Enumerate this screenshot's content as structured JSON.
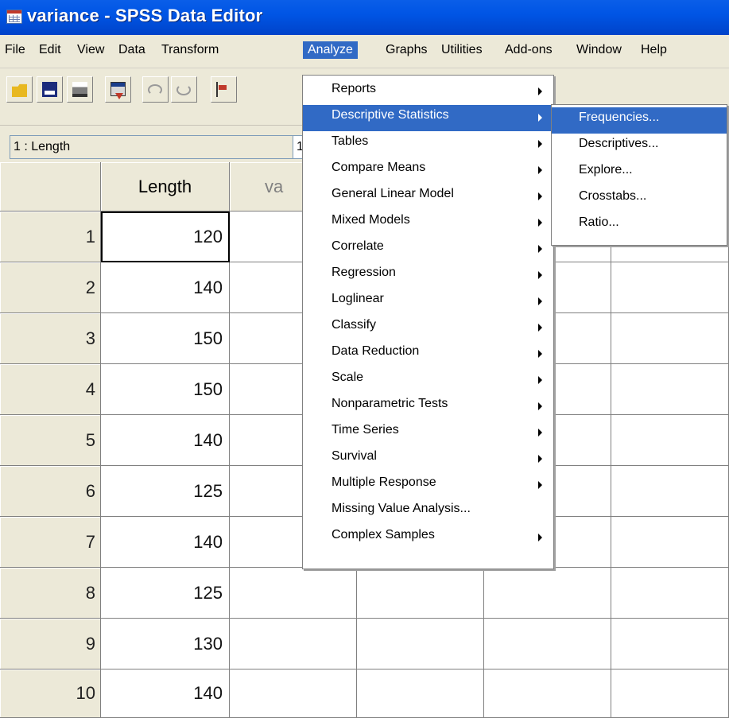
{
  "window": {
    "title": "variance - SPSS Data Editor"
  },
  "menubar": {
    "items": [
      {
        "label": "File"
      },
      {
        "label": "Edit"
      },
      {
        "label": "View"
      },
      {
        "label": "Data"
      },
      {
        "label": "Transform"
      },
      {
        "label": "Analyze"
      },
      {
        "label": "Graphs"
      },
      {
        "label": "Utilities"
      },
      {
        "label": "Add-ons"
      },
      {
        "label": "Window"
      },
      {
        "label": "Help"
      }
    ],
    "open_menu": "Analyze"
  },
  "toolbar": {
    "buttons": [
      "open-file-icon",
      "save-icon",
      "print-icon",
      "dialog-recall-icon",
      "undo-icon",
      "redo-icon",
      "goto-case-icon"
    ]
  },
  "cell_editor": {
    "reference": "1 : Length",
    "value": "1"
  },
  "grid": {
    "columns": [
      "Length",
      "va"
    ],
    "rows": [
      {
        "n": "1",
        "length": "120"
      },
      {
        "n": "2",
        "length": "140"
      },
      {
        "n": "3",
        "length": "150"
      },
      {
        "n": "4",
        "length": "150"
      },
      {
        "n": "5",
        "length": "140"
      },
      {
        "n": "6",
        "length": "125"
      },
      {
        "n": "7",
        "length": "140"
      },
      {
        "n": "8",
        "length": "125"
      },
      {
        "n": "9",
        "length": "130"
      },
      {
        "n": "10",
        "length": "140"
      }
    ]
  },
  "analyze_menu": {
    "items": [
      {
        "label": "Reports",
        "submenu": true
      },
      {
        "label": "Descriptive Statistics",
        "submenu": true,
        "highlighted": true
      },
      {
        "label": "Tables",
        "submenu": true
      },
      {
        "label": "Compare Means",
        "submenu": true
      },
      {
        "label": "General Linear Model",
        "submenu": true
      },
      {
        "label": "Mixed Models",
        "submenu": true
      },
      {
        "label": "Correlate",
        "submenu": true
      },
      {
        "label": "Regression",
        "submenu": true
      },
      {
        "label": "Loglinear",
        "submenu": true
      },
      {
        "label": "Classify",
        "submenu": true
      },
      {
        "label": "Data Reduction",
        "submenu": true
      },
      {
        "label": "Scale",
        "submenu": true
      },
      {
        "label": "Nonparametric Tests",
        "submenu": true
      },
      {
        "label": "Time Series",
        "submenu": true
      },
      {
        "label": "Survival",
        "submenu": true
      },
      {
        "label": "Multiple Response",
        "submenu": true
      },
      {
        "label": "Missing Value Analysis...",
        "submenu": false
      },
      {
        "label": "Complex Samples",
        "submenu": true
      }
    ]
  },
  "descriptive_submenu": {
    "items": [
      {
        "label": "Frequencies...",
        "highlighted": true
      },
      {
        "label": "Descriptives..."
      },
      {
        "label": "Explore..."
      },
      {
        "label": "Crosstabs..."
      },
      {
        "label": "Ratio..."
      }
    ]
  },
  "colors": {
    "titlebar": "#0055e5",
    "highlight": "#316ac5",
    "chrome": "#ece9d8"
  }
}
